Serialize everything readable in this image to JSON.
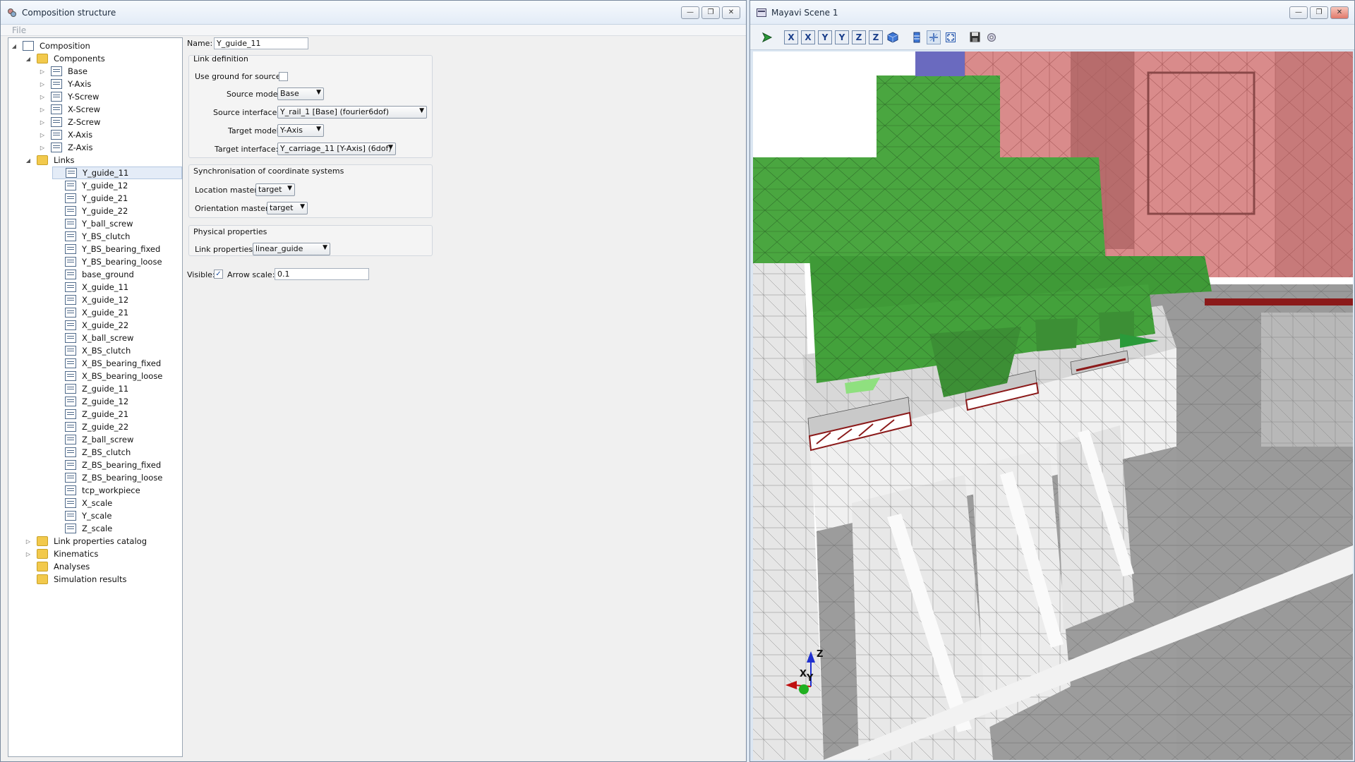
{
  "left_window": {
    "title": "Composition structure",
    "menu": {
      "file": "File"
    }
  },
  "tree": {
    "root": "Composition",
    "components_label": "Components",
    "components": [
      "Base",
      "Y-Axis",
      "Y-Screw",
      "X-Screw",
      "Z-Screw",
      "X-Axis",
      "Z-Axis"
    ],
    "links_label": "Links",
    "links": [
      "Y_guide_11",
      "Y_guide_12",
      "Y_guide_21",
      "Y_guide_22",
      "Y_ball_screw",
      "Y_BS_clutch",
      "Y_BS_bearing_fixed",
      "Y_BS_bearing_loose",
      "base_ground",
      "X_guide_11",
      "X_guide_12",
      "X_guide_21",
      "X_guide_22",
      "X_ball_screw",
      "X_BS_clutch",
      "X_BS_bearing_fixed",
      "X_BS_bearing_loose",
      "Z_guide_11",
      "Z_guide_12",
      "Z_guide_21",
      "Z_guide_22",
      "Z_ball_screw",
      "Z_BS_clutch",
      "Z_BS_bearing_fixed",
      "Z_BS_bearing_loose",
      "tcp_workpiece",
      "X_scale",
      "Y_scale",
      "Z_scale"
    ],
    "other_folders": [
      "Link properties catalog",
      "Kinematics",
      "Analyses",
      "Simulation results"
    ]
  },
  "form": {
    "name_label": "Name:",
    "name_value": "Y_guide_11",
    "link_definition_title": "Link definition",
    "use_ground_label": "Use ground for source:",
    "use_ground_checked": false,
    "source_model_label": "Source model:",
    "source_model_value": "Base",
    "source_interface_label": "Source interface:",
    "source_interface_value": "Y_rail_1 [Base] (fourier6dof)",
    "target_model_label": "Target model:",
    "target_model_value": "Y-Axis",
    "target_interface_label": "Target interface:",
    "target_interface_value": "Y_carriage_11 [Y-Axis] (6dof)",
    "sync_title": "Synchronisation of coordinate systems",
    "location_master_label": "Location master:",
    "location_master_value": "target",
    "orientation_master_label": "Orientation master:",
    "orientation_master_value": "target",
    "physical_title": "Physical properties",
    "link_properties_label": "Link properties:",
    "link_properties_value": "linear_guide",
    "visible_label": "Visible:",
    "visible_checked": true,
    "arrow_scale_label": "Arrow scale:",
    "arrow_scale_value": "0.1"
  },
  "right_window": {
    "title": "Mayavi Scene 1",
    "toolbar_icons": [
      "pipeline-icon",
      "view-x-icon",
      "view-minus-x-icon",
      "view-y-icon",
      "view-minus-y-icon",
      "view-z-icon",
      "view-minus-z-icon",
      "isometric-icon",
      "parallel-projection-icon",
      "axes-toggle-icon",
      "fullscreen-icon",
      "save-icon",
      "settings-icon"
    ],
    "toolbar_letters": {
      "x": "X",
      "y": "Y",
      "z": "Z"
    },
    "axes_labels": {
      "x": "X",
      "y": "Y",
      "z": "Z"
    }
  },
  "colors": {
    "green_part": "#4aa640",
    "pink_part": "#d98b8b",
    "grey_structure": "#9a9a9a",
    "light_structure": "#e6e6e6",
    "rail_red": "#a01c1c"
  }
}
